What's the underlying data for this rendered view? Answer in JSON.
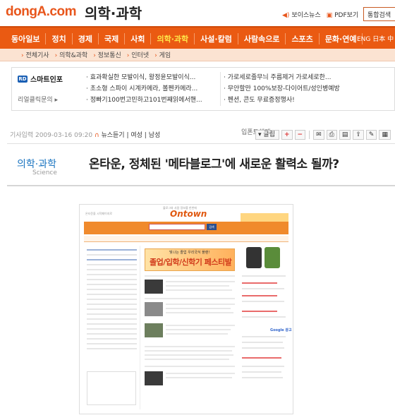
{
  "header": {
    "logo": "dongA.com",
    "section": "의학·과학",
    "voice_news": "보이스뉴스",
    "pdf": "PDF보기",
    "search_button": "통합검색"
  },
  "nav": {
    "items": [
      "동아일보",
      "정치",
      "경제",
      "국제",
      "사회",
      "의학·과학",
      "사설·칼럼",
      "사람속으로",
      "스포츠",
      "문화·연예"
    ],
    "active_index": 5,
    "lang": "ENG 日本 中"
  },
  "subnav": {
    "items": [
      "전체기사",
      "의학&과학",
      "정보통신",
      "인터넷",
      "게임"
    ]
  },
  "ad": {
    "brand": "스마트인포",
    "brand_badge": "RD",
    "sub": "리얼클릭문의",
    "col1": [
      "효과확실한 모발이식, 왕정윤모발이식...",
      "초소형 스파이 시계카메라, 볼펜카메라...",
      "정빠기100번고민하고101번째읽에서핸..."
    ],
    "col2": [
      "가로세로줄무늬 주름제거 가로세로한...",
      "무안할만 100%보장-다이어트/성인병예방",
      "펜션, 콘도 무료증정행사!"
    ]
  },
  "article": {
    "info": "기사입력 2009-03-16 09:20",
    "news_listen": "뉴스듣기",
    "male": "여성",
    "female": "남성",
    "font_label": "입폰트해제",
    "font_button": "글립",
    "category": "의학·과학",
    "category_sub": "Science",
    "headline": "온타운, 정체된 '메타블로그'에 새로운 활력소 될까?"
  },
  "toolbar": {
    "plus": "+",
    "minus": "−"
  },
  "embedded": {
    "logo": "Ontown",
    "logo_sub": "블로그와 사람 정보를 한번에",
    "top_left": "온타운을 시작페이지로",
    "banner_top": "빛나는 졸업 우리국식 플랜!",
    "banner_text": "졸업/입학/신학기 페스티발",
    "search_label": "검색",
    "google": "Google 광고"
  }
}
